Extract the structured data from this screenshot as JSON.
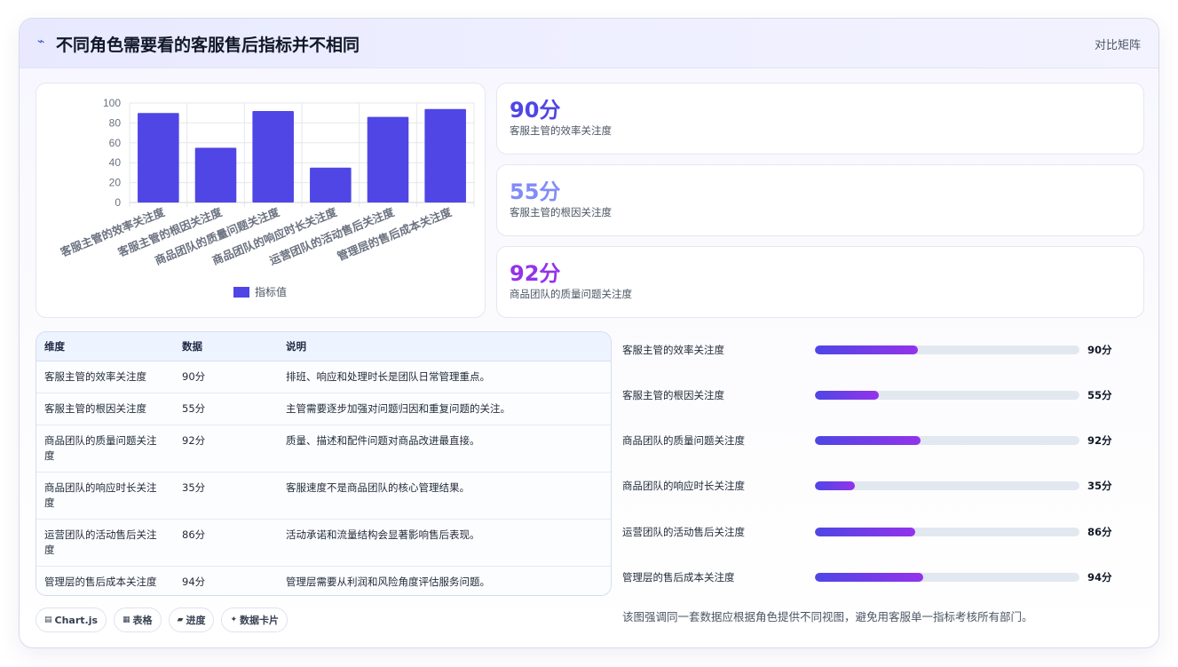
{
  "header": {
    "icon": "chart-line-icon",
    "title": "不同角色需要看的客服售后指标并不相同",
    "tag": "对比矩阵"
  },
  "chart_data": {
    "type": "bar",
    "categories": [
      "客服主管的效率关注度",
      "客服主管的根因关注度",
      "商品团队的质量问题关注度",
      "商品团队的响应时长关注度",
      "运营团队的活动售后关注度",
      "管理层的售后成本关注度"
    ],
    "series": [
      {
        "name": "指标值",
        "values": [
          90,
          55,
          92,
          35,
          86,
          94
        ],
        "color": "#4f46e5"
      }
    ],
    "ylim": [
      0,
      100
    ],
    "yticks": [
      0,
      20,
      40,
      60,
      80,
      100
    ],
    "legend_position": "bottom",
    "grid": true
  },
  "stats": [
    {
      "value": "90分",
      "label": "客服主管的效率关注度",
      "color": "#4f46e5"
    },
    {
      "value": "55分",
      "label": "客服主管的根因关注度",
      "color": "#818cf8"
    },
    {
      "value": "92分",
      "label": "商品团队的质量问题关注度",
      "color": "#9333ea"
    }
  ],
  "table": {
    "headers": [
      "维度",
      "数据",
      "说明"
    ],
    "rows": [
      [
        "客服主管的效率关注度",
        "90分",
        "排班、响应和处理时长是团队日常管理重点。"
      ],
      [
        "客服主管的根因关注度",
        "55分",
        "主管需要逐步加强对问题归因和重复问题的关注。"
      ],
      [
        "商品团队的质量问题关注度",
        "92分",
        "质量、描述和配件问题对商品改进最直接。"
      ],
      [
        "商品团队的响应时长关注度",
        "35分",
        "客服速度不是商品团队的核心管理结果。"
      ],
      [
        "运营团队的活动售后关注度",
        "86分",
        "活动承诺和流量结构会显著影响售后表现。"
      ],
      [
        "管理层的售后成本关注度",
        "94分",
        "管理层需要从利润和风险角度评估服务问题。"
      ]
    ]
  },
  "progress": [
    {
      "label": "客服主管的效率关注度",
      "value": "90分",
      "fraction": 0.39
    },
    {
      "label": "客服主管的根因关注度",
      "value": "55分",
      "fraction": 0.24
    },
    {
      "label": "商品团队的质量问题关注度",
      "value": "92分",
      "fraction": 0.4
    },
    {
      "label": "商品团队的响应时长关注度",
      "value": "35分",
      "fraction": 0.15
    },
    {
      "label": "运营团队的活动售后关注度",
      "value": "86分",
      "fraction": 0.38
    },
    {
      "label": "管理层的售后成本关注度",
      "value": "94分",
      "fraction": 0.41
    }
  ],
  "chips": [
    {
      "icon": "▤",
      "label": "Chart.js"
    },
    {
      "icon": "▦",
      "label": "表格"
    },
    {
      "icon": "▰",
      "label": "进度"
    },
    {
      "icon": "✦",
      "label": "数据卡片"
    }
  ],
  "note": "该图强调同一套数据应根据角色提供不同视图，避免用客服单一指标考核所有部门。"
}
